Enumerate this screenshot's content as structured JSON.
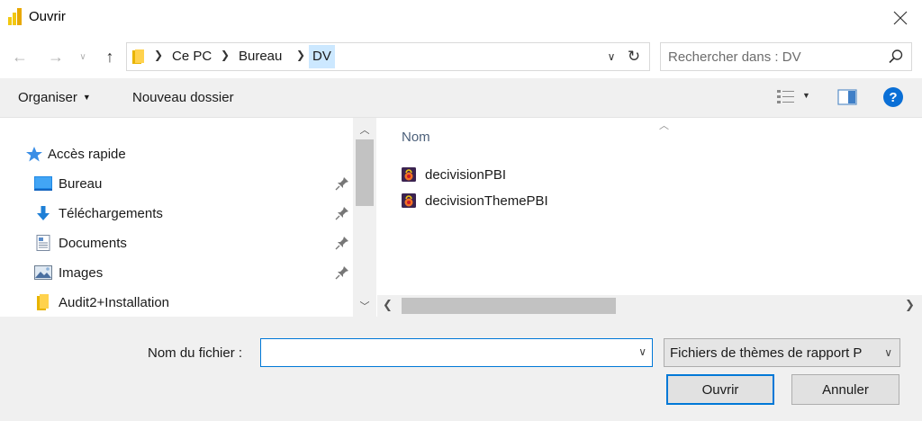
{
  "window": {
    "title": "Ouvrir",
    "app_icon": "power-bi-logo-icon",
    "close_icon": "close-icon"
  },
  "address": {
    "breadcrumbs": [
      "Ce PC",
      "Bureau",
      "DV"
    ],
    "folder_icon": "folder-icon",
    "refresh_icon": "refresh-icon",
    "dropdown_icon": "chevron-down-icon"
  },
  "search": {
    "placeholder": "Rechercher dans : DV",
    "value": ""
  },
  "toolbar": {
    "organiser_label": "Organiser",
    "new_folder_label": "Nouveau dossier",
    "help_label": "?"
  },
  "nav": {
    "items": [
      {
        "label": "Accès rapide",
        "icon": "star-icon",
        "pinned": false
      },
      {
        "label": "Bureau",
        "icon": "desktop-icon",
        "pinned": true
      },
      {
        "label": "Téléchargements",
        "icon": "download-icon",
        "pinned": true
      },
      {
        "label": "Documents",
        "icon": "document-icon",
        "pinned": true
      },
      {
        "label": "Images",
        "icon": "images-icon",
        "pinned": true
      },
      {
        "label": "Audit2+Installation",
        "icon": "folder-icon",
        "pinned": false
      }
    ]
  },
  "files": {
    "column_name": "Nom",
    "items": [
      {
        "name": "decivisionPBI",
        "icon": "pbi-theme-file-icon"
      },
      {
        "name": "decivisionThemePBI",
        "icon": "pbi-theme-file-icon"
      }
    ]
  },
  "bottom": {
    "filename_label": "Nom du fichier :",
    "filename_value": "",
    "filetype_selected": "Fichiers de thèmes de rapport P",
    "open_label": "Ouvrir",
    "cancel_label": "Annuler"
  },
  "colors": {
    "accent": "#0078d7",
    "selection": "#cce8ff",
    "chrome": "#f0f0f0",
    "help_blue": "#0a6fd6"
  }
}
